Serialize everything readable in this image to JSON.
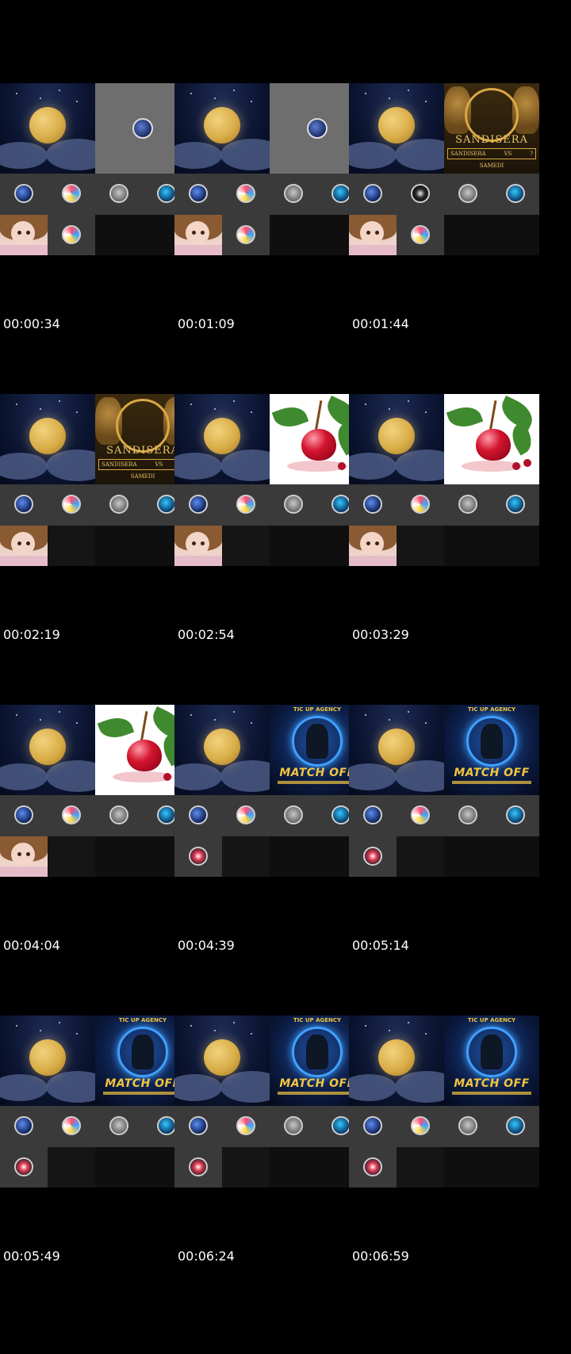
{
  "thumbnails": [
    {
      "timestamp": "00:00:34",
      "right": "gray",
      "second_row": "girl-swirl"
    },
    {
      "timestamp": "00:01:09",
      "right": "gray",
      "second_row": "girl-swirl"
    },
    {
      "timestamp": "00:01:44",
      "right": "sandi",
      "second_row": "girl-swirl"
    },
    {
      "timestamp": "00:02:19",
      "right": "sandi",
      "second_row": "girl"
    },
    {
      "timestamp": "00:02:54",
      "right": "cherry",
      "second_row": "girl"
    },
    {
      "timestamp": "00:03:29",
      "right": "cherry",
      "second_row": "girl"
    },
    {
      "timestamp": "00:04:04",
      "right": "cherry",
      "second_row": "girl"
    },
    {
      "timestamp": "00:04:39",
      "right": "match",
      "second_row": "ring"
    },
    {
      "timestamp": "00:05:14",
      "right": "match",
      "second_row": "ring"
    },
    {
      "timestamp": "00:05:49",
      "right": "match",
      "second_row": "ring"
    },
    {
      "timestamp": "00:06:24",
      "right": "match",
      "second_row": "ring"
    },
    {
      "timestamp": "00:06:59",
      "right": "match",
      "second_row": "ring"
    }
  ],
  "poster_sandi": {
    "title": "SANDISERA",
    "left_name": "SANDISERA",
    "vs": "VS",
    "unknown": "?",
    "day": "SAMEDI"
  },
  "poster_match": {
    "header": "TIC UP AGENCY",
    "title": "MATCH OFF"
  },
  "colors": {
    "background": "#000000",
    "tile_gray": "#3a3a3a",
    "poster_gold": "#e8c46c",
    "match_yellow": "#f2c540"
  }
}
